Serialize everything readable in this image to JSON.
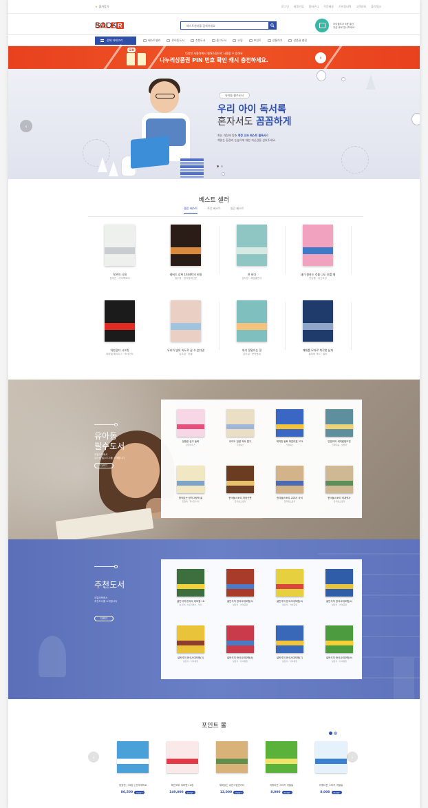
{
  "topbar": {
    "favorite": "즐겨찾기",
    "links": [
      "로그인",
      "회원가입",
      "장바구니",
      "주문배송",
      "기프팅내역",
      "고객센터",
      "출석체크"
    ]
  },
  "header": {
    "logo_sale": "SALE",
    "logo_r": "R",
    "logo_book": "BOOK",
    "search_placeholder": "베스트셀러를 검색하세요",
    "ad_line1": "아이들도서 6종 출간",
    "ad_line2": "지금 바로 만나보세요"
  },
  "nav": {
    "all_categories": "전체 카테고리",
    "items": [
      "베스트셀러",
      "유아동도서",
      "추천도서",
      "중고도서",
      "쇼핑",
      "포인트",
      "선물하기",
      "상품권 충전"
    ]
  },
  "promo": {
    "line1": "다양한 사용처에서 컬쳐쇼핑으로 사용할 수 있어요",
    "line2": "나누리상품권 PIN 번호 확인 캐시 충전하세요.",
    "gift_tag": "Gift"
  },
  "hero": {
    "pill": "유아동 필수도서",
    "headline1": "우리 아이 독서록",
    "headline2_pre": "혼자서도 ",
    "headline2_em": "꼼꼼하게",
    "desc1_pre": "최신 과정에 맞춘 ",
    "desc1_em": "개정 교과 베스트 필독서",
    "desc1_post": "로",
    "desc2": "책읽는 환경과 눈높이에 대한 자신감을 심어주세요."
  },
  "bestseller": {
    "title": "베스트 셀러",
    "tabs": [
      "월간 베스트",
      "주간 베스트",
      "일간 베스트"
    ],
    "books": [
      {
        "title": "작은의 시대",
        "author": "정세진 · 라이팩토리",
        "color": "#eef0ee",
        "accent": "#c9cdd2"
      },
      {
        "title": "레버드 상위 1퍼센트의 비밀",
        "author": "정주영 · 한국경제신문",
        "color": "#2a1d18",
        "accent": "#d98a3c"
      },
      {
        "title": "연 바다",
        "author": "공지영 · 해냄출판사",
        "color": "#8fc6c3",
        "accent": "#d7e9e3"
      },
      {
        "title": "내가 원하는 것을 나도 모를 때",
        "author": "전승환 · 다산초당",
        "color": "#f0a2bf",
        "accent": "#3d7ac7"
      },
      {
        "title": "억만장자 시크릿",
        "author": "라파엘 배지아그 · 토네이도",
        "color": "#1b1b1b",
        "accent": "#e02a22"
      },
      {
        "title": "우리가 빛의 속도로 갈 수 없다면",
        "author": "김초엽 · 허블",
        "color": "#e9cfc4",
        "accent": "#9fc4dd"
      },
      {
        "title": "여기 정말이는 땅",
        "author": "김이설 · 문학동네",
        "color": "#7fbfbe",
        "accent": "#f4c27a"
      },
      {
        "title": "매대를 모자로 착각한 남자",
        "author": "올리버 색스 · 알마",
        "color": "#1f3b6b",
        "accent": "#8fa6c8"
      }
    ]
  },
  "kids": {
    "title_line1": "유아동",
    "title_line2": "필수도서",
    "desc_line1": "세일러북에서",
    "desc_line2": "유아동 필수도서를 소개합니다",
    "more": "더보기",
    "books": [
      {
        "title": "엉뚱한 공주 동화",
        "author": "큰곰자리스",
        "color": "#f7d6e5",
        "accent": "#e54f7c"
      },
      {
        "title": "아이도 한발 과속 법구",
        "author": "가꿈북스",
        "color": "#eadfc4",
        "accent": "#9fb6d9"
      },
      {
        "title": "재미판 동화 마연대표 225",
        "author": "가꿈북스",
        "color": "#3b67c4",
        "accent": "#f3c43a"
      },
      {
        "title": "빈일어의 세계탐험도전",
        "author": "크레마숲 · 초들러",
        "color": "#5e8f9d",
        "accent": "#f0d27a"
      },
      {
        "title": "명작없는 정막그림책 골",
        "author": "한일북 · 제시판시리",
        "color": "#f1e7c2",
        "accent": "#7da3c9"
      },
      {
        "title": "한국들스토리 개정신판",
        "author": "한국들스토리",
        "color": "#6a3c22",
        "accent": "#e6c16e"
      },
      {
        "title": "한국들스토리 교과서 국어",
        "author": "한국들스토리",
        "color": "#d3b48a",
        "accent": "#4b6cb3"
      },
      {
        "title": "한국들스토리 세계역사",
        "author": "한국들스토리",
        "color": "#cfb995",
        "accent": "#5c8e5a"
      }
    ]
  },
  "recommend": {
    "title": "추천도서",
    "desc_line1": "세일러북에서",
    "desc_line2": "추천도서를 소개합니다",
    "more": "더보기",
    "books": [
      {
        "title": "설민석의 한국사 대모험 18",
        "author": "설 민석, 스토리박스 · 아이",
        "color": "#3d6f3e",
        "accent": "#f2d13a"
      },
      {
        "title": "설민석의 한국사대모험(5)",
        "author": "설민석 · 아이휴먼",
        "color": "#a93b2b",
        "accent": "#4c7ac9"
      },
      {
        "title": "설민석의 한국사대모험(6)",
        "author": "설민석 · 아이휴먼",
        "color": "#e7d03f",
        "accent": "#d9473a"
      },
      {
        "title": "설민석의 한국사대모험(4)",
        "author": "설민석 · 아이휴먼",
        "color": "#2f5da8",
        "accent": "#e8c33c"
      },
      {
        "title": "설민석의 한국사대모험(3)",
        "author": "설민석 · 아이휴먼",
        "color": "#e9c43b",
        "accent": "#8f3d2d"
      },
      {
        "title": "설민석의 한국사대모험(8)",
        "author": "설민석 · 아이휴먼",
        "color": "#c93b4b",
        "accent": "#4a7cc4"
      },
      {
        "title": "설민석의 한국사대모험(7)",
        "author": "설민석 · 아이휴먼",
        "color": "#3a68b8",
        "accent": "#f0c640"
      },
      {
        "title": "설민석의 한국사대모험(9)",
        "author": "설민석 · 아이휴먼",
        "color": "#4c9b3f",
        "accent": "#f3cf3a"
      }
    ]
  },
  "pointmall": {
    "title": "포인트 몰",
    "unit": "POINT",
    "items": [
      {
        "title": "정정현 | 96점 | 한국계프로",
        "price": "86,500",
        "color": "#4aa1d9",
        "accent": "#ffffff"
      },
      {
        "title": "레인보우 세미펜 10점",
        "price": "149,000",
        "color": "#fbe9ea",
        "accent": "#e23a46"
      },
      {
        "title": "재미있는 쉬운그림연기다",
        "price": "12,000",
        "color": "#d9b27a",
        "accent": "#5f8f4a"
      },
      {
        "title": "어휘다운 스티커 색칠놀",
        "price": "8,000",
        "color": "#5bb23a",
        "accent": "#f2e36a"
      },
      {
        "title": "어휘다운 스티커 색칠놀",
        "price": "8,000",
        "color": "#e5f2fb",
        "accent": "#3b7fd0"
      }
    ]
  }
}
